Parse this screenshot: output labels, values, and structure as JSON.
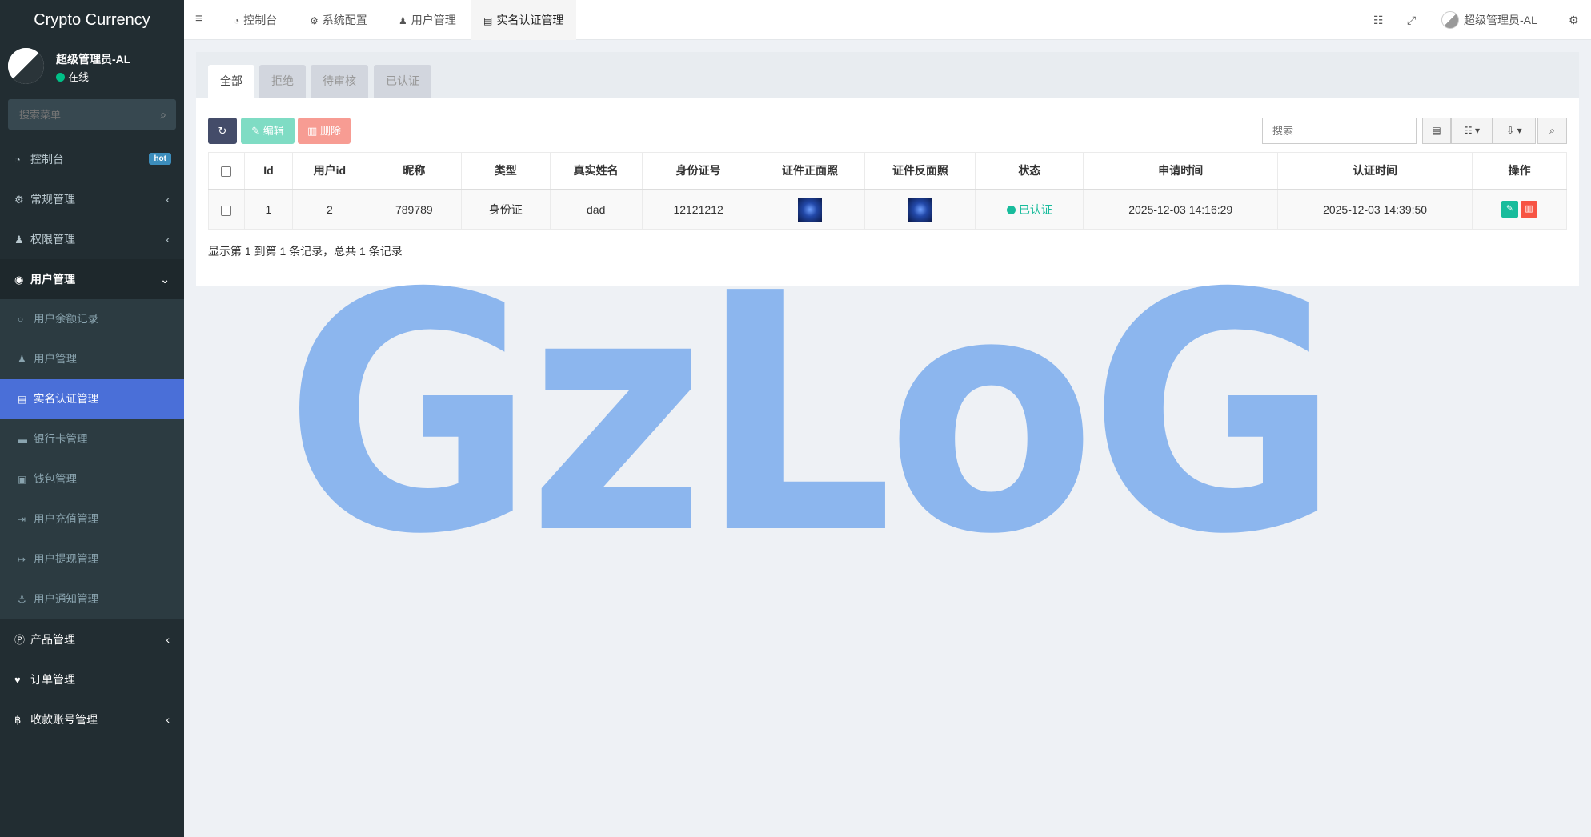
{
  "app": {
    "title": "Crypto Currency"
  },
  "user": {
    "name": "超级管理员-AL",
    "status": "在线"
  },
  "sidebar": {
    "search_placeholder": "搜索菜单",
    "items": [
      {
        "label": "控制台",
        "icon": "dashboard-icon",
        "badge": "hot"
      },
      {
        "label": "常规管理",
        "icon": "cogs-icon"
      },
      {
        "label": "权限管理",
        "icon": "group-icon"
      },
      {
        "label": "用户管理",
        "icon": "user-circle-icon"
      }
    ],
    "sub_items": [
      {
        "label": "用户余额记录",
        "icon": "circle-icon"
      },
      {
        "label": "用户管理",
        "icon": "user-icon"
      },
      {
        "label": "实名认证管理",
        "icon": "id-card-icon"
      },
      {
        "label": "银行卡管理",
        "icon": "credit-card-icon"
      },
      {
        "label": "钱包管理",
        "icon": "money-icon"
      },
      {
        "label": "用户充值管理",
        "icon": "sign-in-icon"
      },
      {
        "label": "用户提现管理",
        "icon": "sign-out-icon"
      },
      {
        "label": "用户通知管理",
        "icon": "anchor-icon"
      }
    ],
    "more_items": [
      {
        "label": "产品管理",
        "icon": "product-icon"
      },
      {
        "label": "订单管理",
        "icon": "heartbeat-icon"
      },
      {
        "label": "收款账号管理",
        "icon": "bitcoin-icon"
      }
    ]
  },
  "topbar": {
    "tabs": [
      {
        "label": "控制台",
        "icon": "dashboard-icon"
      },
      {
        "label": "系统配置",
        "icon": "gear-icon"
      },
      {
        "label": "用户管理",
        "icon": "user-icon"
      },
      {
        "label": "实名认证管理",
        "icon": "id-card-icon"
      }
    ],
    "user_name": "超级管理员-AL"
  },
  "filter_tabs": [
    "全部",
    "拒绝",
    "待审核",
    "已认证"
  ],
  "toolbar": {
    "edit_label": "编辑",
    "delete_label": "删除",
    "search_placeholder": "搜索"
  },
  "table": {
    "headers": [
      "Id",
      "用户id",
      "昵称",
      "类型",
      "真实姓名",
      "身份证号",
      "证件正面照",
      "证件反面照",
      "状态",
      "申请时间",
      "认证时间",
      "操作"
    ],
    "rows": [
      {
        "id": "1",
        "user_id": "2",
        "nickname": "789789",
        "type": "身份证",
        "real_name": "dad",
        "id_number": "12121212",
        "status": "已认证",
        "apply_time": "2025-12-03 14:16:29",
        "verify_time": "2025-12-03 14:39:50"
      }
    ]
  },
  "pagination": {
    "summary": "显示第 1 到第 1 条记录，总共 1 条记录"
  },
  "watermark": {
    "text": "GzLoG"
  },
  "colors": {
    "sidebar_bg": "#222d32",
    "active": "#4a6fd8",
    "success": "#18bc9c",
    "danger": "#f75444"
  }
}
